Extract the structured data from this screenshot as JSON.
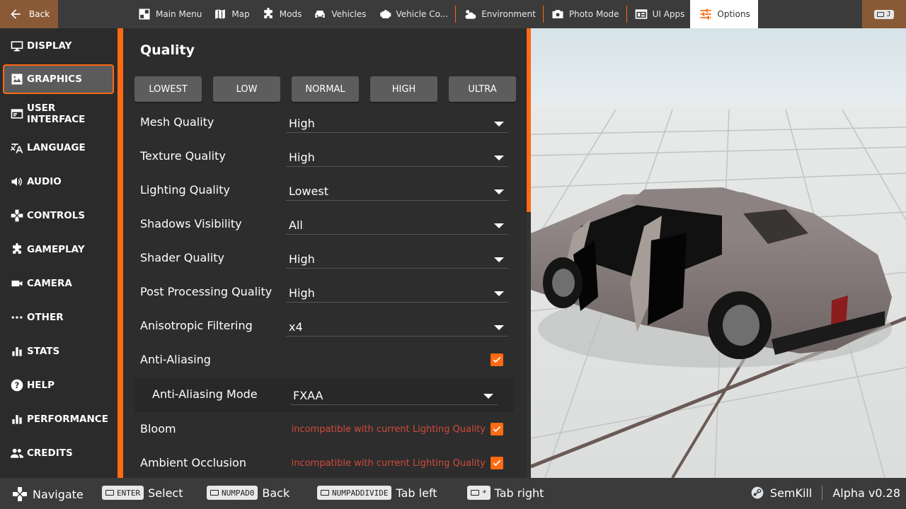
{
  "topbar": {
    "back_label": "Back",
    "tabs": [
      {
        "label": "Main Menu",
        "icon": "main-menu-icon"
      },
      {
        "label": "Map",
        "icon": "map-icon"
      },
      {
        "label": "Mods",
        "icon": "puzzle-icon"
      },
      {
        "label": "Vehicles",
        "icon": "car-icon"
      },
      {
        "label": "Vehicle Co...",
        "icon": "engine-icon"
      },
      {
        "label": "Environment",
        "icon": "weather-icon"
      },
      {
        "label": "Photo Mode",
        "icon": "camera-icon"
      },
      {
        "label": "UI Apps",
        "icon": "apps-icon"
      },
      {
        "label": "Options",
        "icon": "sliders-icon"
      }
    ],
    "active_tab": "Options",
    "right_key": "J"
  },
  "sidebar": {
    "items": [
      {
        "label": "DISPLAY",
        "icon": "monitor-icon"
      },
      {
        "label": "GRAPHICS",
        "icon": "image-icon"
      },
      {
        "label": "USER INTERFACE",
        "icon": "window-icon"
      },
      {
        "label": "LANGUAGE",
        "icon": "translate-icon"
      },
      {
        "label": "AUDIO",
        "icon": "speaker-icon"
      },
      {
        "label": "CONTROLS",
        "icon": "gamepad-icon"
      },
      {
        "label": "GAMEPLAY",
        "icon": "puzzle-icon"
      },
      {
        "label": "CAMERA",
        "icon": "video-camera-icon"
      },
      {
        "label": "OTHER",
        "icon": "dots-icon"
      },
      {
        "label": "STATS",
        "icon": "bar-chart-icon"
      },
      {
        "label": "HELP",
        "icon": "help-icon"
      },
      {
        "label": "PERFORMANCE",
        "icon": "bar-chart-icon"
      },
      {
        "label": "CREDITS",
        "icon": "people-icon"
      }
    ],
    "active": "GRAPHICS"
  },
  "panel": {
    "title": "Quality",
    "presets": [
      "LOWEST",
      "LOW",
      "NORMAL",
      "HIGH",
      "ULTRA"
    ],
    "settings": {
      "mesh_quality": {
        "label": "Mesh Quality",
        "value": "High"
      },
      "texture_quality": {
        "label": "Texture Quality",
        "value": "High"
      },
      "lighting_quality": {
        "label": "Lighting Quality",
        "value": "Lowest"
      },
      "shadows_visibility": {
        "label": "Shadows Visibility",
        "value": "All"
      },
      "shader_quality": {
        "label": "Shader Quality",
        "value": "High"
      },
      "post_processing_quality": {
        "label": "Post Processing Quality",
        "value": "High"
      },
      "anisotropic_filtering": {
        "label": "Anisotropic Filtering",
        "value": "x4"
      },
      "anti_aliasing": {
        "label": "Anti-Aliasing",
        "checked": true
      },
      "anti_aliasing_mode": {
        "label": "Anti-Aliasing Mode",
        "value": "FXAA"
      },
      "bloom": {
        "label": "Bloom",
        "warning": "incompatible with current Lighting Quality",
        "checked": true
      },
      "ambient_occlusion": {
        "label": "Ambient Occlusion",
        "warning": "incompatible with current Lighting Quality",
        "checked": true
      }
    }
  },
  "bottombar": {
    "navigate": "Navigate",
    "select_key": "ENTER",
    "select_label": "Select",
    "back_key": "NUMPAD0",
    "back_label": "Back",
    "tab_left_key": "NUMPADDIVIDE",
    "tab_left_label": "Tab left",
    "tab_right_key": "*",
    "tab_right_label": "Tab right",
    "username": "SemKill",
    "version": "Alpha v0.28"
  },
  "colors": {
    "accent": "#ff6a13",
    "back_block": "#8a5a37",
    "warning": "#d14a3a",
    "bar": "#3b3b3b"
  }
}
